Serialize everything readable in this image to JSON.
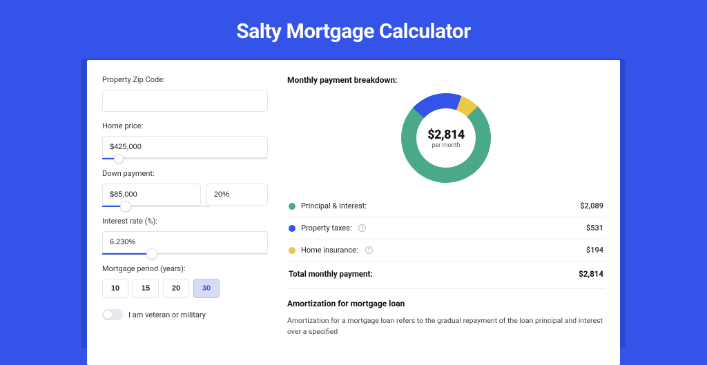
{
  "page": {
    "title": "Salty Mortgage Calculator"
  },
  "form": {
    "zip_label": "Property Zip Code:",
    "zip_value": "",
    "home_price_label": "Home price:",
    "home_price_value": "$425,000",
    "home_price_slider_pct": 10,
    "down_payment_label": "Down payment:",
    "down_payment_value": "$85,000",
    "down_payment_pct_value": "20%",
    "down_payment_slider_pct": 22,
    "interest_label": "Interest rate (%):",
    "interest_value": "6.230%",
    "interest_slider_pct": 30,
    "period_label": "Mortgage period (years):",
    "periods": [
      "10",
      "15",
      "20",
      "30"
    ],
    "period_active_index": 3,
    "veteran_label": "I am veteran or military",
    "veteran_on": false
  },
  "breakdown": {
    "title": "Monthly payment breakdown:",
    "center_amount": "$2,814",
    "center_sub": "per month",
    "items": [
      {
        "color": "green",
        "label": "Principal & Interest:",
        "value": "$2,089",
        "info": false
      },
      {
        "color": "blue",
        "label": "Property taxes:",
        "value": "$531",
        "info": true
      },
      {
        "color": "yellow",
        "label": "Home insurance:",
        "value": "$194",
        "info": true
      }
    ],
    "total_label": "Total monthly payment:",
    "total_value": "$2,814"
  },
  "amortization": {
    "title": "Amortization for mortgage loan",
    "text": "Amortization for a mortgage loan refers to the gradual repayment of the loan principal and interest over a specified"
  },
  "chart_data": {
    "type": "pie",
    "title": "Monthly payment breakdown",
    "series": [
      {
        "name": "Principal & Interest",
        "value": 2089,
        "color": "#4aa98a"
      },
      {
        "name": "Property taxes",
        "value": 531,
        "color": "#3353e9"
      },
      {
        "name": "Home insurance",
        "value": 194,
        "color": "#e9c94a"
      }
    ],
    "total": 2814,
    "unit": "USD per month"
  }
}
